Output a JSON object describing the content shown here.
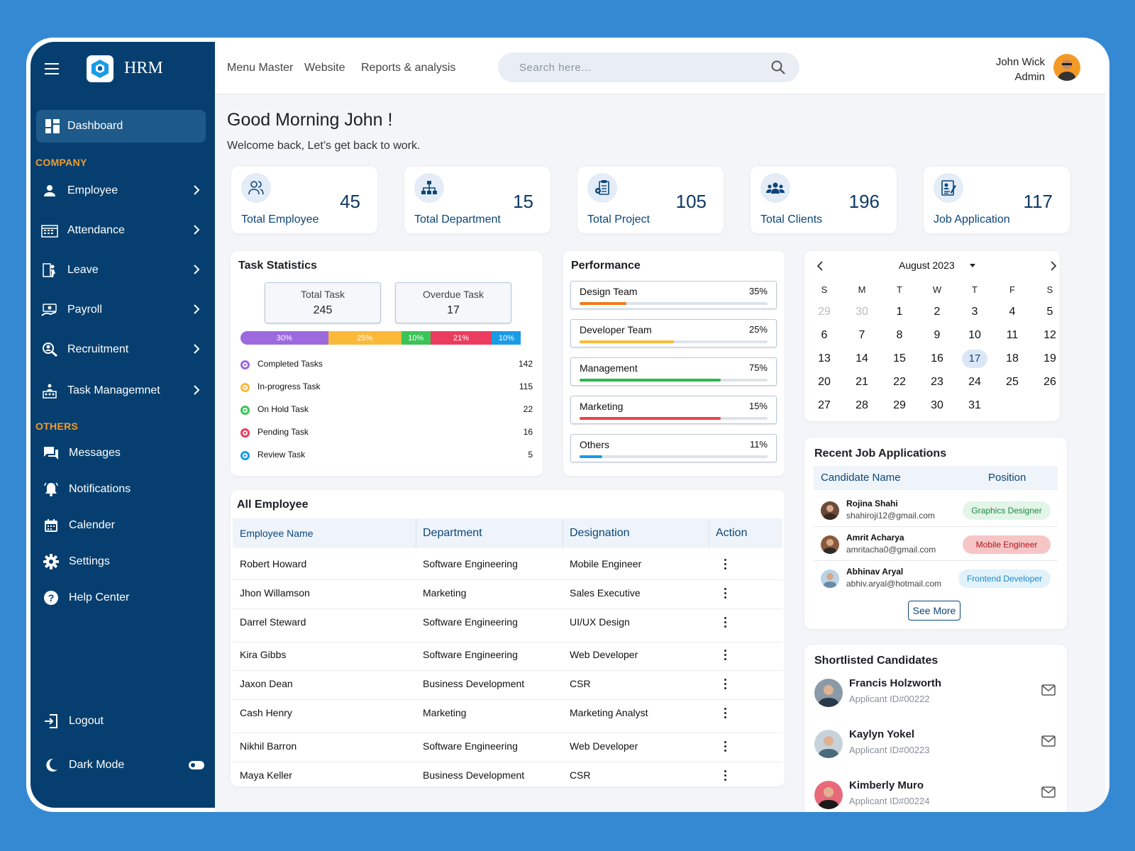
{
  "app": {
    "name": "HRM"
  },
  "sidebar": {
    "dashboard_label": "Dashboard",
    "company_title": "COMPANY",
    "company_items": [
      {
        "label": "Employee",
        "icon": "person-icon"
      },
      {
        "label": "Attendance",
        "icon": "attendance-icon"
      },
      {
        "label": "Leave",
        "icon": "leave-icon"
      },
      {
        "label": "Payroll",
        "icon": "payroll-icon"
      },
      {
        "label": "Recruitment",
        "icon": "recruitment-icon"
      },
      {
        "label": "Task Managemnet",
        "icon": "task-icon"
      }
    ],
    "others_title": "OTHERS",
    "others_items": [
      {
        "label": "Messages",
        "icon": "messages-icon"
      },
      {
        "label": "Notifications",
        "icon": "bell-icon"
      },
      {
        "label": "Calender",
        "icon": "calendar-icon"
      },
      {
        "label": "Settings",
        "icon": "gear-icon"
      },
      {
        "label": "Help Center",
        "icon": "help-icon"
      }
    ],
    "logout_label": "Logout",
    "dark_mode_label": "Dark Mode"
  },
  "topbar": {
    "menu": [
      "Menu Master",
      "Website",
      "Reports & analysis"
    ],
    "search_placeholder": "Search here...",
    "user_name": "John Wick",
    "user_role": "Admin"
  },
  "greeting": {
    "title": "Good Morning John !",
    "subtitle": "Welcome back, Let’s get back to work."
  },
  "stats": [
    {
      "value": "45",
      "label": "Total Employee",
      "icon": "users-icon"
    },
    {
      "value": "15",
      "label": "Total Department",
      "icon": "org-chart-icon"
    },
    {
      "value": "105",
      "label": "Total Project",
      "icon": "project-icon"
    },
    {
      "value": "196",
      "label": "Total Clients",
      "icon": "clients-icon"
    },
    {
      "value": "117",
      "label": "Job Application",
      "icon": "application-icon"
    }
  ],
  "task_statistics": {
    "title": "Task Statistics",
    "total_label": "Total Task",
    "total_value": "245",
    "overdue_label": "Overdue Task",
    "overdue_value": "17",
    "segments": [
      {
        "label": "30%",
        "percent": 30,
        "color": "#9c6ade"
      },
      {
        "label": "25%",
        "percent": 25,
        "color": "#fbb93a"
      },
      {
        "label": "10%",
        "percent": 10,
        "color": "#3cc457"
      },
      {
        "label": "21%",
        "percent": 21,
        "color": "#eb3c5f"
      },
      {
        "label": "10%",
        "percent": 10,
        "color": "#1a9be6"
      }
    ],
    "legend": [
      {
        "name": "Completed Tasks",
        "value": "142",
        "color": "#9c6ade"
      },
      {
        "name": "In-progress Task",
        "value": "115",
        "color": "#fbb93a"
      },
      {
        "name": "On Hold Task",
        "value": "22",
        "color": "#3cc457"
      },
      {
        "name": "Pending Task",
        "value": "16",
        "color": "#eb3c5f"
      },
      {
        "name": "Review Task",
        "value": "5",
        "color": "#1a9be6"
      }
    ]
  },
  "performance": {
    "title": "Performance",
    "items": [
      {
        "name": "Design Team",
        "percent_label": "35%",
        "fill": 0.25,
        "color": "#f07a1a"
      },
      {
        "name": "Developer Team",
        "percent_label": "25%",
        "fill": 0.5,
        "color": "#fbb93a"
      },
      {
        "name": "Management",
        "percent_label": "75%",
        "fill": 0.75,
        "color": "#2eb84b"
      },
      {
        "name": "Marketing",
        "percent_label": "15%",
        "fill": 0.75,
        "color": "#e8434c"
      },
      {
        "name": "Others",
        "percent_label": "11%",
        "fill": 0.12,
        "color": "#1a9be6"
      }
    ]
  },
  "calendar": {
    "month": "August 2023",
    "weekdays": [
      "S",
      "M",
      "T",
      "W",
      "T",
      "F",
      "S"
    ],
    "weeks": [
      [
        "29",
        "30",
        "1",
        "2",
        "3",
        "4",
        "5"
      ],
      [
        "6",
        "7",
        "8",
        "9",
        "10",
        "11",
        "12"
      ],
      [
        "13",
        "14",
        "15",
        "16",
        "17",
        "18",
        "19"
      ],
      [
        "20",
        "21",
        "22",
        "23",
        "24",
        "25",
        "26"
      ],
      [
        "27",
        "28",
        "29",
        "30",
        "31",
        "",
        ""
      ]
    ],
    "selected": "17"
  },
  "all_employee": {
    "title": "All Employee",
    "columns": [
      "Employee Name",
      "Department",
      "Designation",
      "Action"
    ],
    "rows": [
      [
        "Robert Howard",
        "Software Engineering",
        "Mobile Engineer"
      ],
      [
        "Jhon Willamson",
        "Marketing",
        "Sales Executive"
      ],
      [
        "Darrel Steward",
        "Software Engineering",
        "UI/UX Design"
      ],
      [
        "Kira Gibbs",
        "Software Engineering",
        "Web Developer"
      ],
      [
        "Jaxon Dean",
        "Business Development",
        "CSR"
      ],
      [
        "Cash Henry",
        "Marketing",
        "Marketing Analyst"
      ],
      [
        "Nikhil Barron",
        "Software Engineering",
        "Web Developer"
      ],
      [
        "Maya Keller",
        "Business Development",
        "CSR"
      ]
    ]
  },
  "recent_jobs": {
    "title": "Recent Job Applications",
    "col_name": "Candidate Name",
    "col_position": "Position",
    "rows": [
      {
        "name": "Rojina Shahi",
        "email": "shahiroji12@gmail.com",
        "position": "Graphics Designer",
        "bg": "#e2f5e8",
        "fg": "#1e8a43"
      },
      {
        "name": "Amrit Acharya",
        "email": "amritacha0@gmail.com",
        "position": "Mobile Engineer",
        "bg": "#f6c6c6",
        "fg": "#b0141d"
      },
      {
        "name": "Abhinav Aryal",
        "email": "abhiv.aryal@hotmail.com",
        "position": "Frontend Developer",
        "bg": "#e1f2fb",
        "fg": "#1a8ac7"
      }
    ],
    "see_more": "See More"
  },
  "shortlisted": {
    "title": "Shortlisted Candidates",
    "items": [
      {
        "name": "Francis Holzworth",
        "id": "Applicant ID#00222"
      },
      {
        "name": "Kaylyn Yokel",
        "id": "Applicant ID#00223"
      },
      {
        "name": "Kimberly Muro",
        "id": "Applicant ID#00224"
      }
    ]
  }
}
